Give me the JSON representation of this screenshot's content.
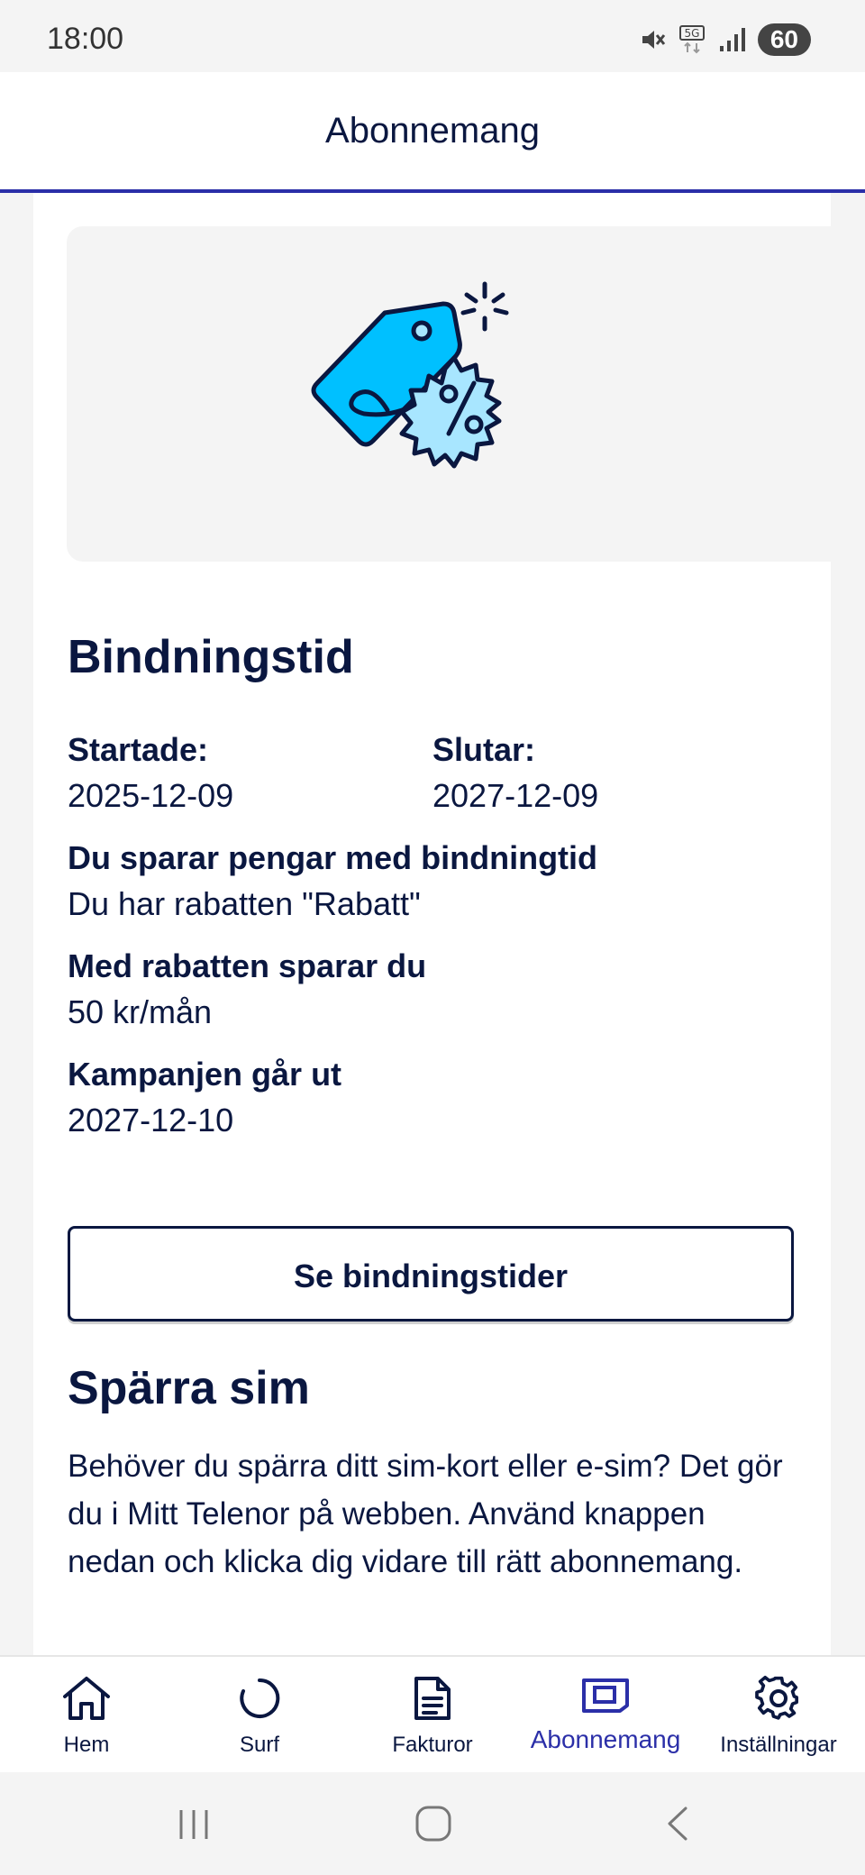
{
  "status": {
    "time": "18:00",
    "battery": "60"
  },
  "header": {
    "title": "Abonnemang"
  },
  "binding": {
    "title": "Bindningstid",
    "start_label": "Startade:",
    "start_value": "2025-12-09",
    "end_label": "Slutar:",
    "end_value": "2027-12-09",
    "savings_label": "Du sparar pengar med bindningtid",
    "savings_value": "Du har rabatten \"Rabatt\"",
    "discount_label": "Med rabatten sparar du",
    "discount_value": "50 kr/mån",
    "campaign_label": "Kampanjen går ut",
    "campaign_value": "2027-12-10",
    "button_label": "Se bindningstider"
  },
  "block_sim": {
    "title": "Spärra sim",
    "text": "Behöver du spärra ditt sim-kort eller e-sim? Det gör du i Mitt Telenor på webben. Använd knappen nedan och klicka dig vidare till rätt abonnemang."
  },
  "nav": {
    "items": [
      {
        "label": "Hem",
        "icon": "home-icon"
      },
      {
        "label": "Surf",
        "icon": "surf-icon"
      },
      {
        "label": "Fakturor",
        "icon": "invoice-icon"
      },
      {
        "label": "Abonnemang",
        "icon": "subscription-icon",
        "active": true
      },
      {
        "label": "Inställningar",
        "icon": "settings-icon"
      }
    ]
  },
  "colors": {
    "accent": "#2b2fa8",
    "text": "#0a1740",
    "tag": "#00c0ff",
    "tag_light": "#a8e6ff"
  }
}
